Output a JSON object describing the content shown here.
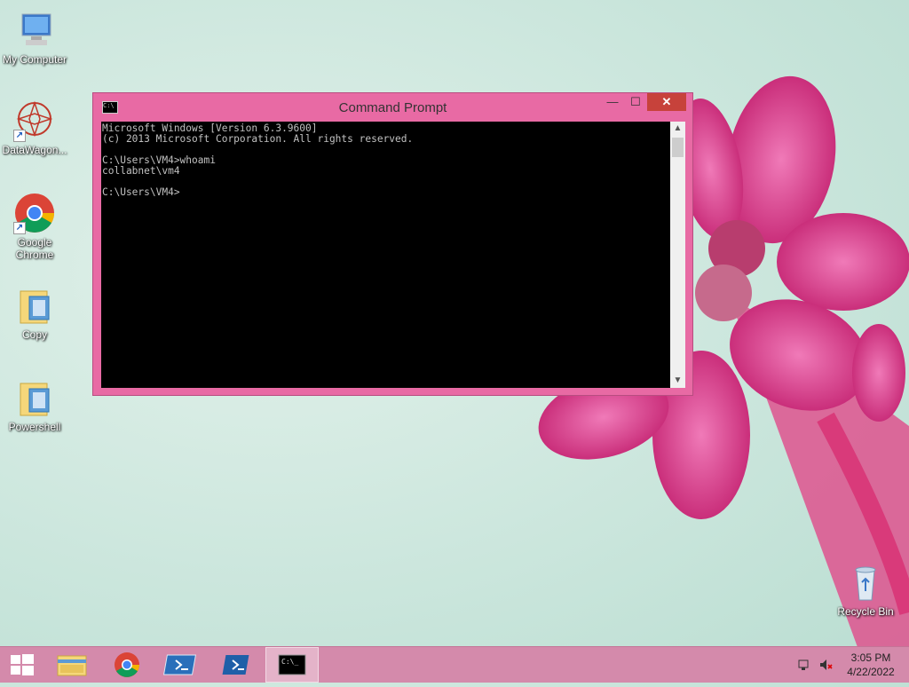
{
  "desktop": {
    "icons": [
      {
        "label": "My Computer"
      },
      {
        "label": "DataWagon..."
      },
      {
        "label": "Google Chrome"
      },
      {
        "label": "Copy"
      },
      {
        "label": "Powershell"
      },
      {
        "label": "Recycle Bin"
      }
    ]
  },
  "window": {
    "title": "Command Prompt",
    "icon_text": "C:\\",
    "minimize": "—",
    "maximize": "☐",
    "close": "✕"
  },
  "console": {
    "text": "Microsoft Windows [Version 6.3.9600]\n(c) 2013 Microsoft Corporation. All rights reserved.\n\nC:\\Users\\VM4>whoami\ncollabnet\\vm4\n\nC:\\Users\\VM4>"
  },
  "taskbar": {
    "clock_time": "3:05 PM",
    "clock_date": "4/22/2022",
    "cmd_icon_text": "C:\\_"
  },
  "colors": {
    "window_frame": "#e86aa4",
    "close_button": "#c7423b",
    "taskbar": "#d48aab"
  }
}
